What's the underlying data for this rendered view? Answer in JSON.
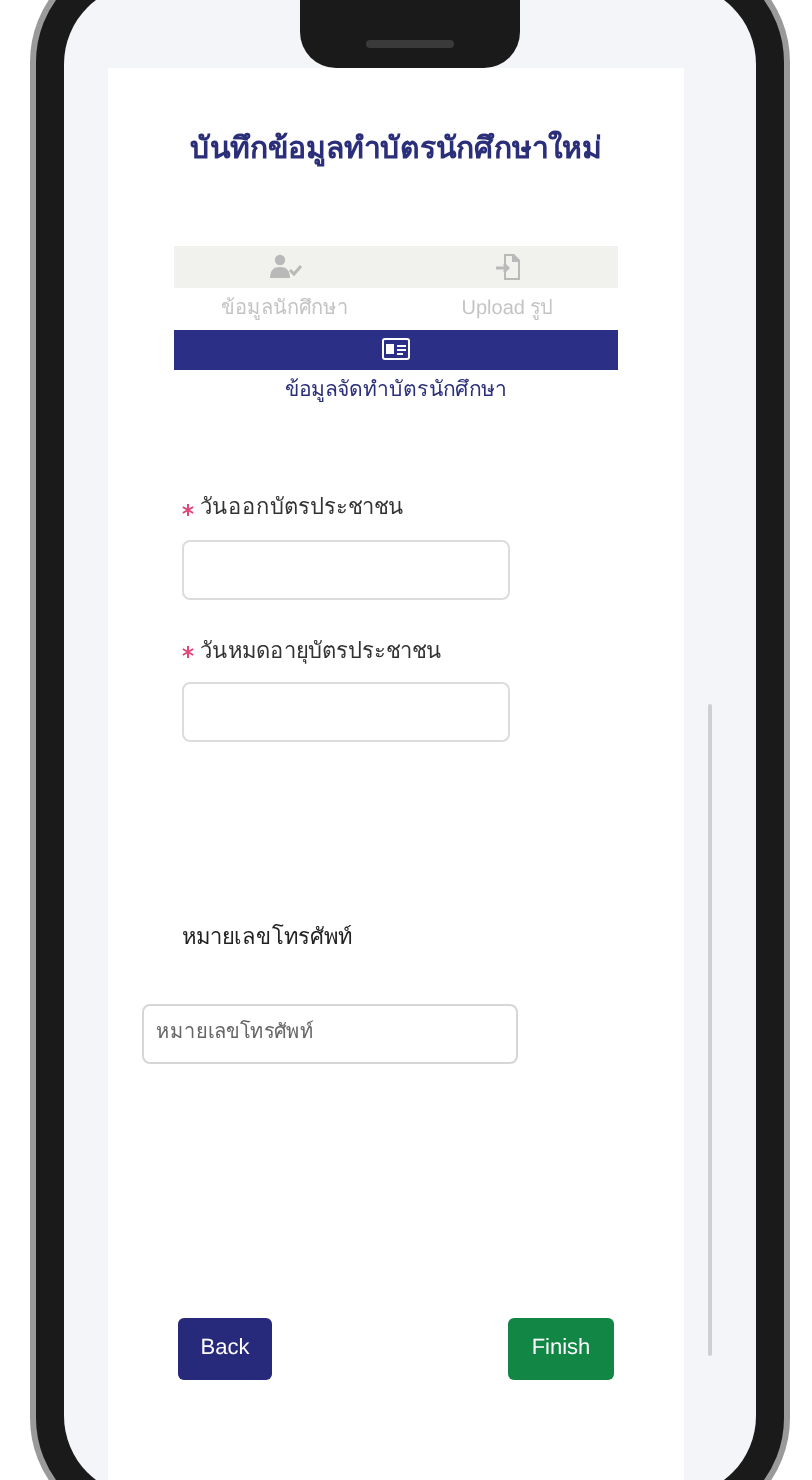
{
  "title": "บันทึกข้อมูลทำบัตรนักศึกษาใหม่",
  "steps": [
    {
      "label": "ข้อมูลนักศึกษา",
      "kind": "person",
      "selected": false
    },
    {
      "label": "Upload รูป",
      "kind": "upload",
      "selected": false
    },
    {
      "label": "ข้อมูลจัดทำบัตรนักศึกษา",
      "kind": "card",
      "selected": true
    }
  ],
  "fields": [
    {
      "label": "วันออกบัตรประชาชน",
      "required": true
    },
    {
      "label": "วันหมดอายุบัตรประชาชน",
      "required": true
    }
  ],
  "phone": {
    "label": "หมายเลขโทรศัพท์",
    "placeholder": "หมายเลขโทรศัพท์"
  },
  "buttons": [
    {
      "label": "Back",
      "kind": "back"
    },
    {
      "label": "Finish",
      "kind": "finish"
    }
  ]
}
